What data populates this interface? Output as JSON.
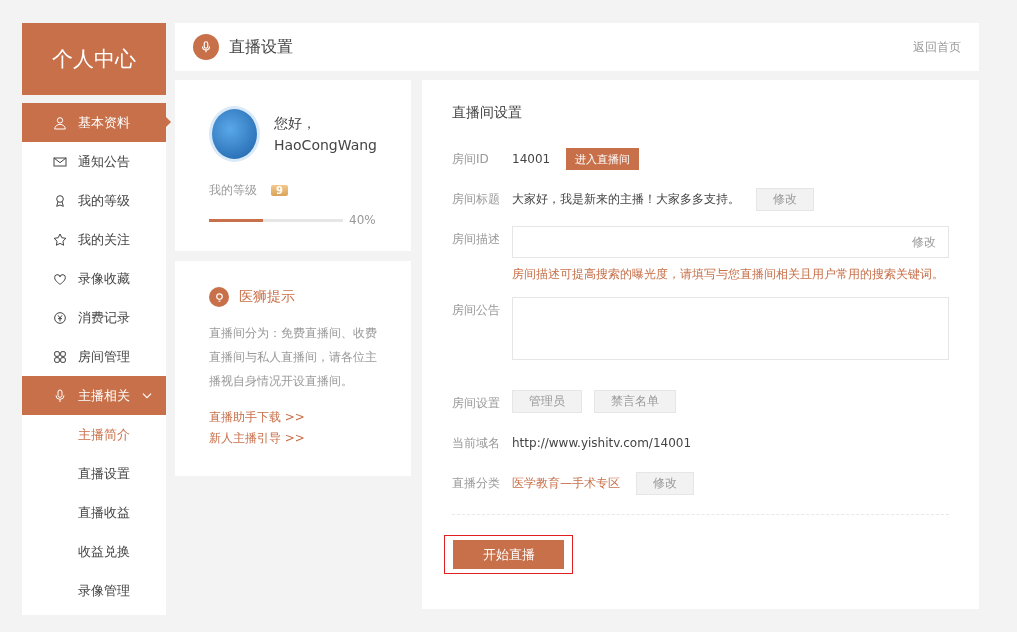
{
  "sidebar": {
    "title": "个人中心",
    "items": [
      {
        "label": "基本资料",
        "selected": true
      },
      {
        "label": "通知公告",
        "selected": false
      },
      {
        "label": "我的等级",
        "selected": false
      },
      {
        "label": "我的关注",
        "selected": false
      },
      {
        "label": "录像收藏",
        "selected": false
      },
      {
        "label": "消费记录",
        "selected": false
      },
      {
        "label": "房间管理",
        "selected": false
      },
      {
        "label": "主播相关",
        "selected": true,
        "expanded": true,
        "children": [
          {
            "label": "主播简介",
            "selected": true
          },
          {
            "label": "直播设置",
            "selected": false
          },
          {
            "label": "直播收益",
            "selected": false
          },
          {
            "label": "收益兑换",
            "selected": false
          },
          {
            "label": "录像管理",
            "selected": false
          }
        ]
      }
    ]
  },
  "header": {
    "title": "直播设置",
    "back_link": "返回首页"
  },
  "profile": {
    "greeting": "您好，",
    "username": "HaoCongWang",
    "level_label": "我的等级",
    "level_badge": "9",
    "level": 0.4,
    "percent": "40%"
  },
  "tips": {
    "title": "医狮提示",
    "text": "直播间分为：免费直播间、收费直播间与私人直播间，请各位主播视自身情况开设直播间。",
    "links": [
      "直播助手下载 >>",
      "新人主播引导 >>"
    ]
  },
  "room": {
    "title": "直播间设置",
    "rows": [
      {
        "kind": "value_action",
        "label": "房间ID",
        "value": "14001",
        "action": "进入直播间"
      },
      {
        "kind": "value_edit",
        "label": "房间标题",
        "value": "大家好，我是新来的主播！大家多多支持。",
        "action": "修改"
      },
      {
        "kind": "field",
        "label": "房间描述",
        "action": "修改",
        "hint": "房间描述可提高搜索的曝光度，请填写与您直播间相关且用户常用的搜索关键词。"
      },
      {
        "kind": "textarea",
        "label": "房间公告"
      },
      {
        "kind": "buttons",
        "label": "房间设置",
        "buttons": [
          "管理员",
          "禁言名单"
        ]
      },
      {
        "kind": "value",
        "label": "当前域名",
        "value": "http://www.yishitv.com/14001"
      },
      {
        "kind": "link_edit",
        "label": "直播分类",
        "value": "医学教育—手术专区",
        "action": "修改"
      }
    ],
    "start_button": {
      "label": "开始直播",
      "focused": true
    }
  }
}
